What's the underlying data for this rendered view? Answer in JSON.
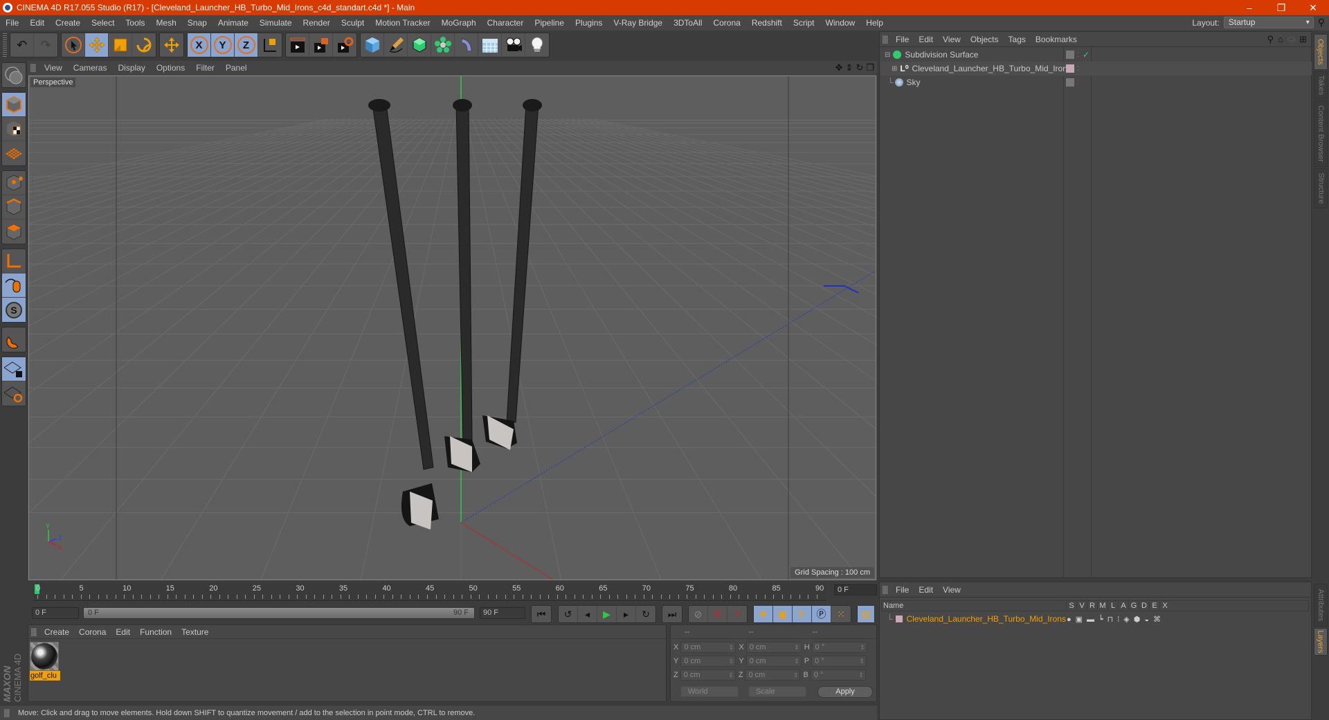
{
  "window": {
    "title": "CINEMA 4D R17.055 Studio (R17) - [Cleveland_Launcher_HB_Turbo_Mid_Irons_c4d_standart.c4d *] - Main",
    "controls": [
      "minimize",
      "restore",
      "close"
    ]
  },
  "menu": [
    "File",
    "Edit",
    "Create",
    "Select",
    "Tools",
    "Mesh",
    "Snap",
    "Animate",
    "Simulate",
    "Render",
    "Sculpt",
    "Motion Tracker",
    "MoGraph",
    "Character",
    "Pipeline",
    "Plugins",
    "V-Ray Bridge",
    "3DToAll",
    "Corona",
    "Redshift",
    "Script",
    "Window",
    "Help"
  ],
  "layout": {
    "label": "Layout:",
    "value": "Startup"
  },
  "toolbar": {
    "groups": [
      [
        "undo-icon",
        "redo-icon"
      ],
      [
        "live-selection-icon",
        "move-icon",
        "scale-icon",
        "rotate-icon"
      ],
      [
        "recent-tool-icon"
      ],
      [
        "x-axis-icon",
        "y-axis-icon",
        "z-axis-icon",
        "coordinate-system-icon"
      ],
      [
        "render-view-icon",
        "render-picture-viewer-icon",
        "render-settings-icon"
      ],
      [
        "cube-icon",
        "pen-icon",
        "subdivision-icon",
        "mograph-cloner-icon",
        "deformer-icon",
        "floor-icon",
        "camera-icon",
        "light-icon"
      ]
    ],
    "axis_labels": [
      "X",
      "Y",
      "Z"
    ]
  },
  "left_toolbar": {
    "items": [
      "make-editable-icon",
      "model-mode-icon",
      "texture-mode-icon",
      "workplane-mode-icon",
      "points-mode-icon",
      "edges-mode-icon",
      "polygons-mode-icon",
      "axis-icon",
      "tweak-icon",
      "solo-icon",
      "snap-icon",
      "locked-workplane-icon",
      "workplane-icon"
    ]
  },
  "viewport": {
    "menu": [
      "View",
      "Cameras",
      "Display",
      "Options",
      "Filter",
      "Panel"
    ],
    "label": "Perspective",
    "grid_spacing": "Grid Spacing : 100 cm",
    "axis_labels": {
      "x": "X",
      "y": "Y",
      "z": "Z"
    }
  },
  "timeline": {
    "ticks": [
      "0",
      "5",
      "10",
      "15",
      "20",
      "25",
      "30",
      "35",
      "40",
      "45",
      "50",
      "55",
      "60",
      "65",
      "70",
      "75",
      "80",
      "85",
      "90"
    ],
    "current_frame": "0 F",
    "start_field": "0 F",
    "slider_start": "0 F",
    "slider_end": "90 F",
    "end_field": "90 F"
  },
  "materials": {
    "menu": [
      "Create",
      "Corona",
      "Edit",
      "Function",
      "Texture"
    ],
    "items": [
      {
        "name": "golf_clu"
      }
    ]
  },
  "coordinates": {
    "headers": [
      "--",
      "--",
      "--"
    ],
    "rows": [
      {
        "l1": "X",
        "v1": "0 cm",
        "l2": "X",
        "v2": "0 cm",
        "l3": "H",
        "v3": "0 °"
      },
      {
        "l1": "Y",
        "v1": "0 cm",
        "l2": "Y",
        "v2": "0 cm",
        "l3": "P",
        "v3": "0 °"
      },
      {
        "l1": "Z",
        "v1": "0 cm",
        "l2": "Z",
        "v2": "0 cm",
        "l3": "B",
        "v3": "0 °"
      }
    ],
    "mode": "World",
    "transform": "Scale",
    "apply": "Apply"
  },
  "brand": {
    "maxon": "MAXON",
    "product": "CINEMA 4D"
  },
  "status": "Move: Click and drag to move elements. Hold down SHIFT to quantize movement / add to the selection in point mode, CTRL to remove.",
  "object_manager": {
    "menu": [
      "File",
      "Edit",
      "View",
      "Objects",
      "Tags",
      "Bookmarks"
    ],
    "objects": [
      {
        "name": "Subdivision Surface",
        "icon": "subdivision-surface-icon",
        "enabled": "✓"
      },
      {
        "name": "Cleveland_Launcher_HB_Turbo_Mid_Irons",
        "icon": "null-object-icon",
        "color": "#c9a9b5"
      },
      {
        "name": "Sky",
        "icon": "sky-icon"
      }
    ]
  },
  "layer_manager": {
    "menu": [
      "File",
      "Edit",
      "View"
    ],
    "header": {
      "name": "Name",
      "cols": [
        "S",
        "V",
        "R",
        "M",
        "L",
        "A",
        "G",
        "D",
        "E",
        "X"
      ]
    },
    "layers": [
      {
        "name": "Cleveland_Launcher_HB_Turbo_Mid_Irons",
        "color": "#c9a9b5"
      }
    ]
  },
  "right_tabs": {
    "top": [
      "Objects",
      "Takes",
      "Content Browser",
      "Structure"
    ],
    "bottom": [
      "Attributes",
      "Layers"
    ]
  },
  "colors": {
    "title_bar": "#d83b01",
    "accent": "#f0a000",
    "active_tab": "#e8a33a"
  }
}
